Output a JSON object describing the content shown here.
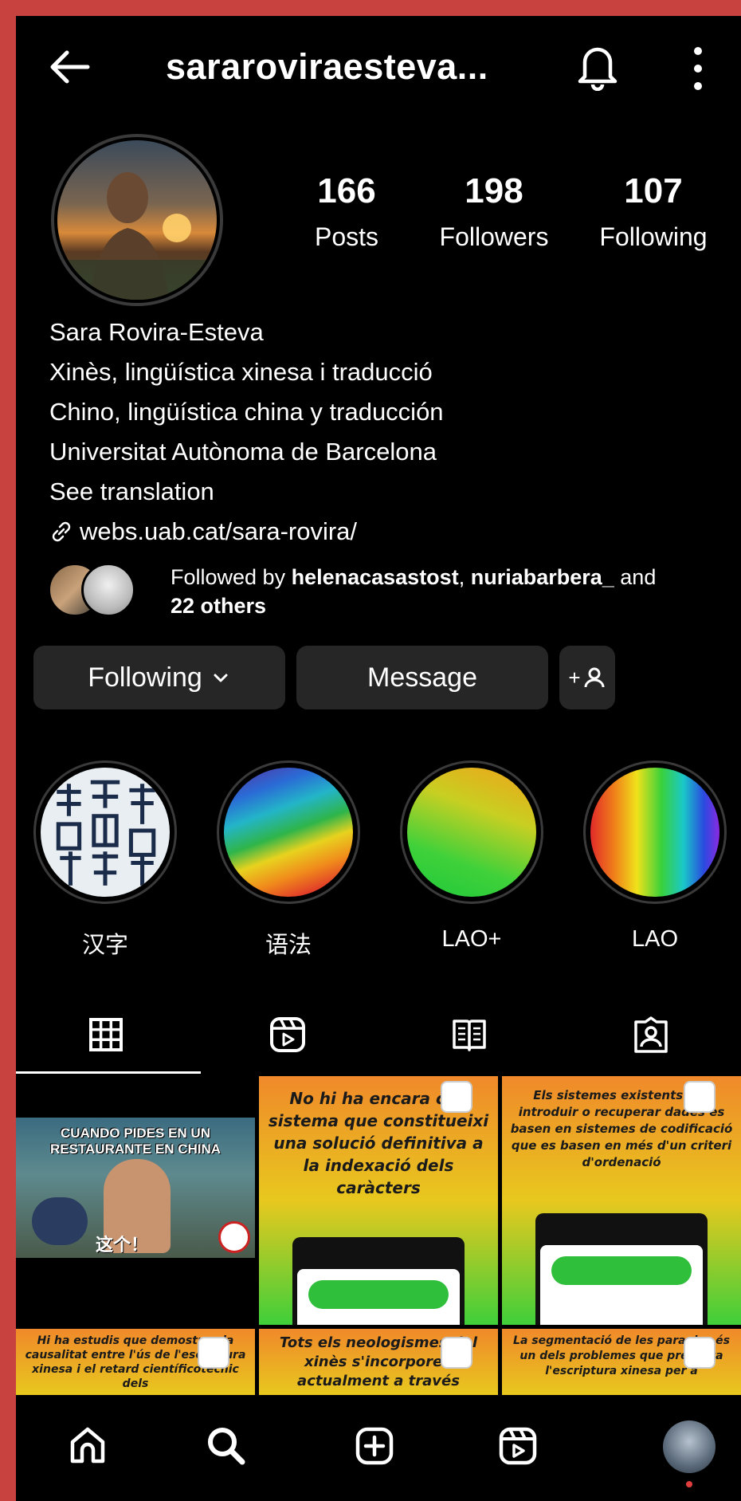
{
  "header": {
    "username": "sararoviraesteva...",
    "back_icon": "arrow-left-icon",
    "bell_icon": "bell-icon",
    "more_icon": "more-vertical-icon"
  },
  "profile": {
    "stats": [
      {
        "value": "166",
        "label": "Posts"
      },
      {
        "value": "198",
        "label": "Followers"
      },
      {
        "value": "107",
        "label": "Following"
      }
    ],
    "bio": {
      "name": "Sara Rovira-Esteva",
      "lines": [
        "Xinès, lingüística xinesa i traducció",
        "Chino, lingüística china y traducción",
        "Universitat Autònoma de Barcelona"
      ],
      "see_translation": "See translation",
      "link": "webs.uab.cat/sara-rovira/"
    },
    "followed_by": {
      "prefix": "Followed by ",
      "user1": "helenacasastost",
      "sep": ", ",
      "user2": "nuriabarbera_",
      "and": " and",
      "others": "22 others"
    }
  },
  "actions": {
    "following_label": "Following",
    "message_label": "Message",
    "add_user_label": "+"
  },
  "highlights": [
    {
      "label": "汉字"
    },
    {
      "label": "语法"
    },
    {
      "label": "LAO+"
    },
    {
      "label": "LAO"
    }
  ],
  "tabs": [
    "grid-icon",
    "reels-icon",
    "guide-icon",
    "tagged-icon"
  ],
  "posts": [
    {
      "text": "CUANDO PIDES EN UN RESTAURANTE EN CHINA",
      "caption": "这个！"
    },
    {
      "text": "No hi ha encara cap sistema que constitueixi una solució definitiva a la indexació dels caràcters"
    },
    {
      "text": "Els sistemes existents per introduir o recuperar dades es basen en sistemes de codificació que es basen en més d'un criteri d'ordenació"
    },
    {
      "text": "Hi ha estudis que demostren la causalitat entre l'ús de l'escriptura xinesa i el retard científicotècnic dels"
    },
    {
      "text": "Tots els neologismes del xinès s'incorporen actualment a través"
    },
    {
      "text": "La segmentació de les paraules és un dels problemes que presenta l'escriptura xinesa per a"
    }
  ],
  "bottom_nav": [
    "home-icon",
    "search-icon",
    "create-icon",
    "reels-icon",
    "profile-avatar"
  ],
  "colors": {
    "background": "#000000",
    "button_bg": "#262626",
    "frame": "#c8423f",
    "notification_dot": "#e03e3e"
  }
}
